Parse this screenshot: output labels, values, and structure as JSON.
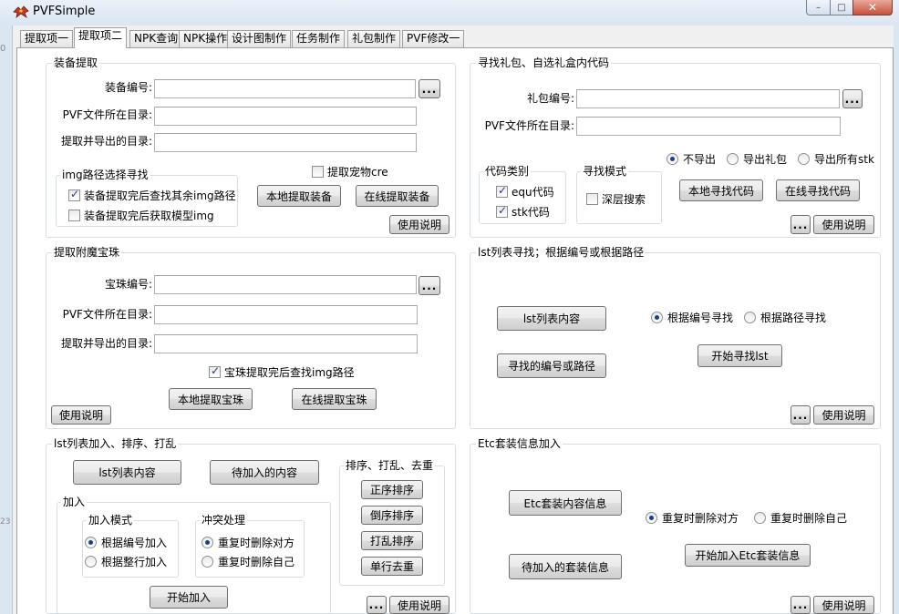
{
  "window": {
    "title": "PVFSimple",
    "controls": {
      "minimize": "–",
      "maximize": "□",
      "close": "✕"
    },
    "background_fragments": [
      "0",
      "23"
    ]
  },
  "tabs": [
    {
      "label": "提取项一",
      "active": false
    },
    {
      "label": "提取项二",
      "active": true
    },
    {
      "label": "NPK查询",
      "active": false
    },
    {
      "label": "NPK操作",
      "active": false
    },
    {
      "label": "设计图制作",
      "active": false
    },
    {
      "label": "任务制作",
      "active": false
    },
    {
      "label": "礼包制作",
      "active": false
    },
    {
      "label": "PVF修改一",
      "active": false
    }
  ],
  "equip": {
    "title": "装备提取",
    "id_label": "装备编号:",
    "dir_label": "PVF文件所在目录:",
    "export_label": "提取并导出的目录:",
    "id_value": "",
    "dir_value": "",
    "export_value": "",
    "browse": "...",
    "img_group_title": "img路径选择寻找",
    "chk_img_find": "装备提取完后查找其余img路径",
    "chk_img_find_checked": true,
    "chk_img_model": "装备提取完后获取模型img",
    "chk_img_model_checked": false,
    "chk_pet": "提取宠物cre",
    "chk_pet_checked": false,
    "btn_local": "本地提取装备",
    "btn_online": "在线提取装备",
    "btn_help": "使用说明"
  },
  "gift": {
    "title": "寻找礼包、自选礼盒内代码",
    "id_label": "礼包编号:",
    "dir_label": "PVF文件所在目录:",
    "id_value": "",
    "dir_value": "",
    "browse": "...",
    "radios": [
      {
        "label": "不导出",
        "checked": true
      },
      {
        "label": "导出礼包",
        "checked": false
      },
      {
        "label": "导出所有stk",
        "checked": false
      }
    ],
    "code_type_title": "代码类别",
    "chk_equ": "equ代码",
    "chk_equ_checked": true,
    "chk_stk": "stk代码",
    "chk_stk_checked": true,
    "search_mode_title": "寻找模式",
    "chk_deep": "深层搜索",
    "chk_deep_checked": false,
    "btn_local": "本地寻找代码",
    "btn_online": "在线寻找代码",
    "btn_dots": "...",
    "btn_help": "使用说明"
  },
  "bead": {
    "title": "提取附魔宝珠",
    "id_label": "宝珠编号:",
    "dir_label": "PVF文件所在目录:",
    "export_label": "提取并导出的目录:",
    "id_value": "",
    "dir_value": "",
    "export_value": "",
    "browse": "...",
    "chk_img": "宝珠提取完后查找img路径",
    "chk_img_checked": true,
    "btn_local": "本地提取宝珠",
    "btn_online": "在线提取宝珠",
    "btn_help": "使用说明"
  },
  "lst_find": {
    "title": "lst列表寻找；根据编号或根据路径",
    "btn_content": "lst列表内容",
    "btn_target": "寻找的编号或路径",
    "radios": [
      {
        "label": "根据编号寻找",
        "checked": true
      },
      {
        "label": "根据路径寻找",
        "checked": false
      }
    ],
    "btn_start": "开始寻找lst",
    "btn_dots": "...",
    "btn_help": "使用说明"
  },
  "lst_add": {
    "title": "lst列表加入、排序、打乱",
    "btn_content": "lst列表内容",
    "btn_pending": "待加入的内容",
    "add_group_title": "加入",
    "mode_title": "加入模式",
    "mode_radios": [
      {
        "label": "根据编号加入",
        "checked": true
      },
      {
        "label": "根据整行加入",
        "checked": false
      }
    ],
    "conflict_title": "冲突处理",
    "conflict_radios": [
      {
        "label": "重复时删除对方",
        "checked": true
      },
      {
        "label": "重复时删除自己",
        "checked": false
      }
    ],
    "btn_start": "开始加入",
    "sort_title": "排序、打乱、去重",
    "btn_asc": "正序排序",
    "btn_desc": "倒序排序",
    "btn_shuffle": "打乱排序",
    "btn_dedupe": "单行去重",
    "btn_dots": "...",
    "btn_help": "使用说明"
  },
  "etc": {
    "title": "Etc套装信息加入",
    "btn_content": "Etc套装内容信息",
    "btn_pending": "待加入的套装信息",
    "radios": [
      {
        "label": "重复时删除对方",
        "checked": true
      },
      {
        "label": "重复时删除自己",
        "checked": false
      }
    ],
    "btn_start": "开始加入Etc套装信息",
    "btn_dots": "...",
    "btn_help": "使用说明"
  }
}
